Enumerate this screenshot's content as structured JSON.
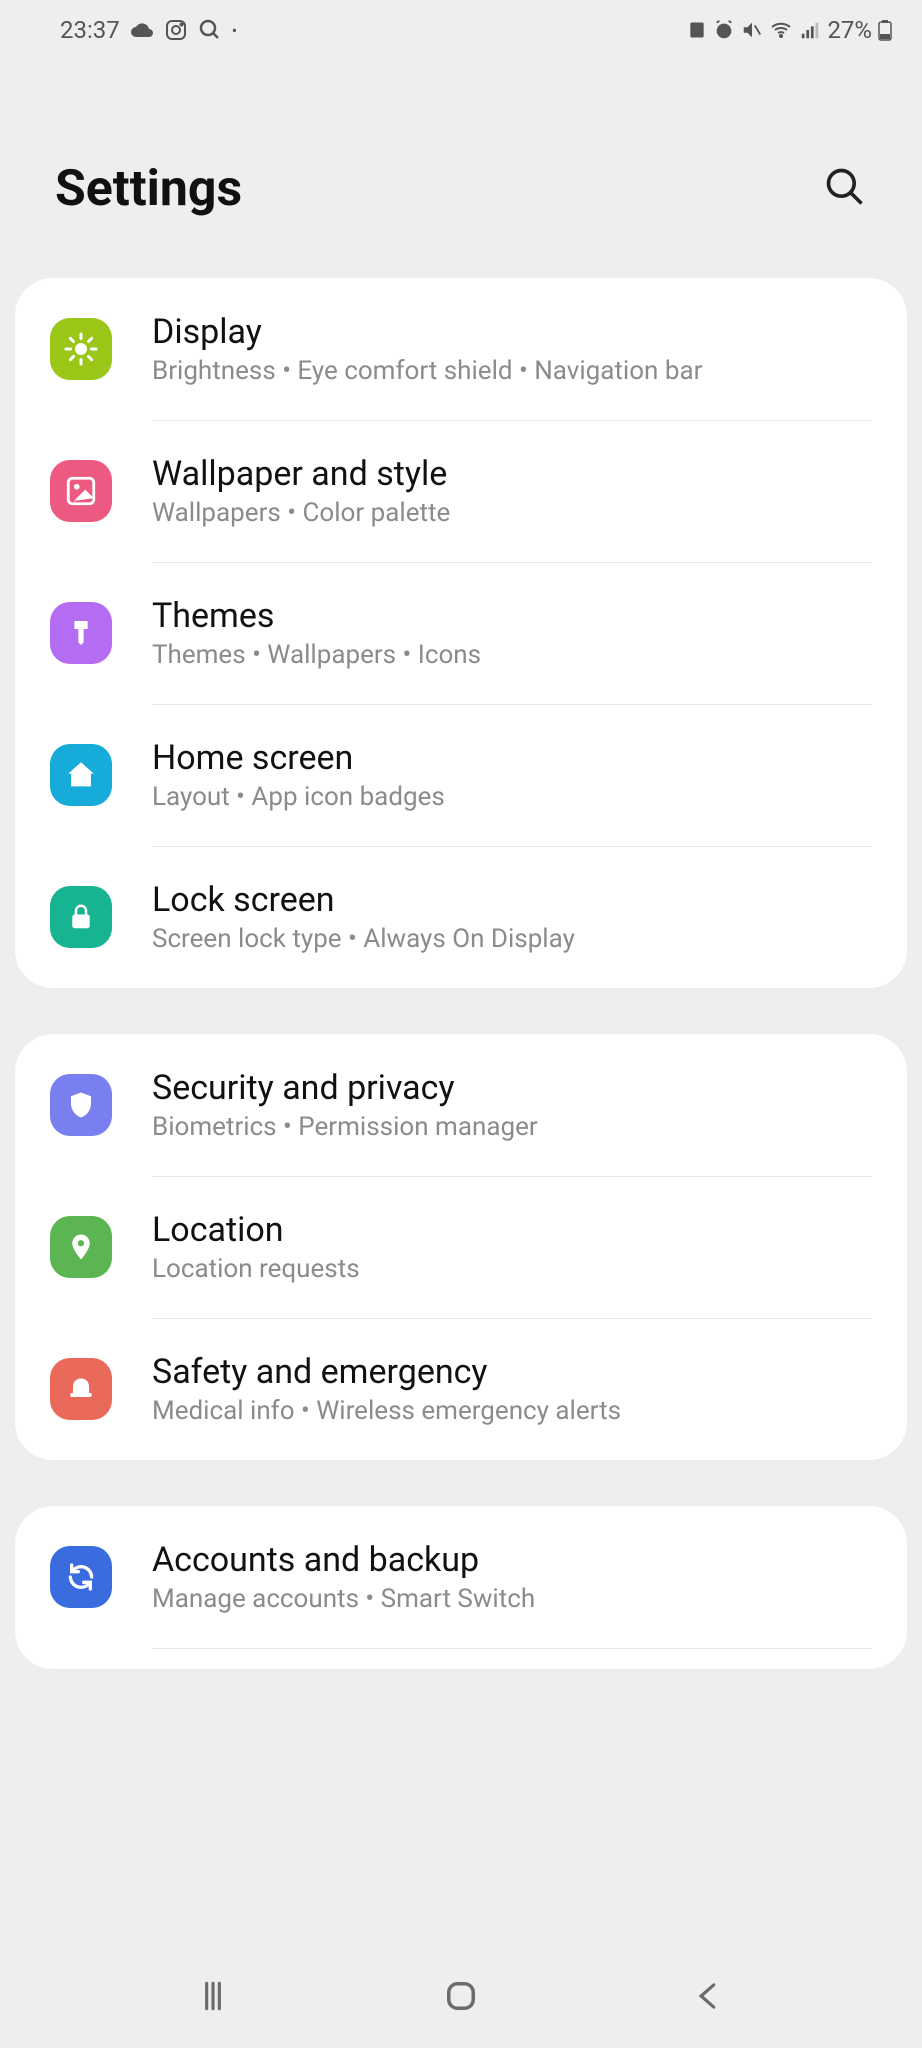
{
  "status": {
    "time": "23:37",
    "battery": "27%"
  },
  "header": {
    "title": "Settings"
  },
  "groups": [
    {
      "items": [
        {
          "key": "display",
          "title": "Display",
          "subtitle": "Brightness • Eye comfort shield • Navigation bar",
          "iconColor": "#9ac617"
        },
        {
          "key": "wallpaper",
          "title": "Wallpaper and style",
          "subtitle": "Wallpapers • Color palette",
          "iconColor": "#ec5a81"
        },
        {
          "key": "themes",
          "title": "Themes",
          "subtitle": "Themes • Wallpapers • Icons",
          "iconColor": "#b46df2"
        },
        {
          "key": "homescreen",
          "title": "Home screen",
          "subtitle": "Layout • App icon badges",
          "iconColor": "#16abd8"
        },
        {
          "key": "lockscreen",
          "title": "Lock screen",
          "subtitle": "Screen lock type • Always On Display",
          "iconColor": "#17b491"
        }
      ]
    },
    {
      "items": [
        {
          "key": "security",
          "title": "Security and privacy",
          "subtitle": "Biometrics • Permission manager",
          "iconColor": "#7a7ff0"
        },
        {
          "key": "location",
          "title": "Location",
          "subtitle": "Location requests",
          "iconColor": "#5ab552"
        },
        {
          "key": "safety",
          "title": "Safety and emergency",
          "subtitle": "Medical info • Wireless emergency alerts",
          "iconColor": "#e9695a"
        }
      ]
    },
    {
      "items": [
        {
          "key": "accounts",
          "title": "Accounts and backup",
          "subtitle": "Manage accounts • Smart Switch",
          "iconColor": "#3a6ce0"
        }
      ]
    }
  ]
}
